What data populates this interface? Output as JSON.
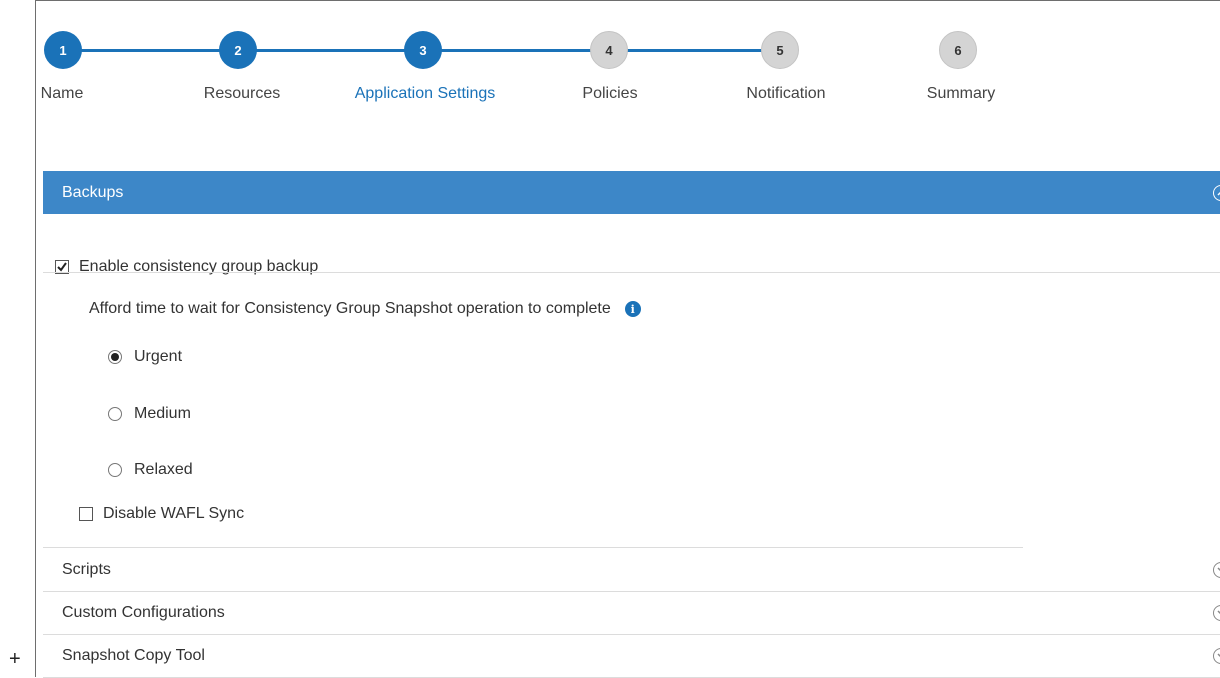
{
  "wizard": {
    "steps": [
      {
        "number": "1",
        "label": "Name"
      },
      {
        "number": "2",
        "label": "Resources"
      },
      {
        "number": "3",
        "label": "Application Settings"
      },
      {
        "number": "4",
        "label": "Policies"
      },
      {
        "number": "5",
        "label": "Notification"
      },
      {
        "number": "6",
        "label": "Summary"
      }
    ],
    "current_step": 3
  },
  "backups": {
    "title": "Backups",
    "expanded": true,
    "enable_cg_backup_label": "Enable consistency group backup",
    "enable_cg_backup_checked": true,
    "wait_time_label": "Afford time to wait for Consistency Group Snapshot operation to complete",
    "options": [
      {
        "label": "Urgent",
        "selected": true
      },
      {
        "label": "Medium",
        "selected": false
      },
      {
        "label": "Relaxed",
        "selected": false
      }
    ],
    "disable_wafl_sync_label": "Disable WAFL Sync",
    "disable_wafl_sync_checked": false
  },
  "sections": [
    {
      "title": "Scripts"
    },
    {
      "title": "Custom Configurations"
    },
    {
      "title": "Snapshot Copy Tool"
    }
  ],
  "outer_glyph": "+",
  "colors": {
    "accent": "#1a72b8",
    "header_bg": "#3d87c8",
    "pending_step": "#d4d4d4"
  }
}
